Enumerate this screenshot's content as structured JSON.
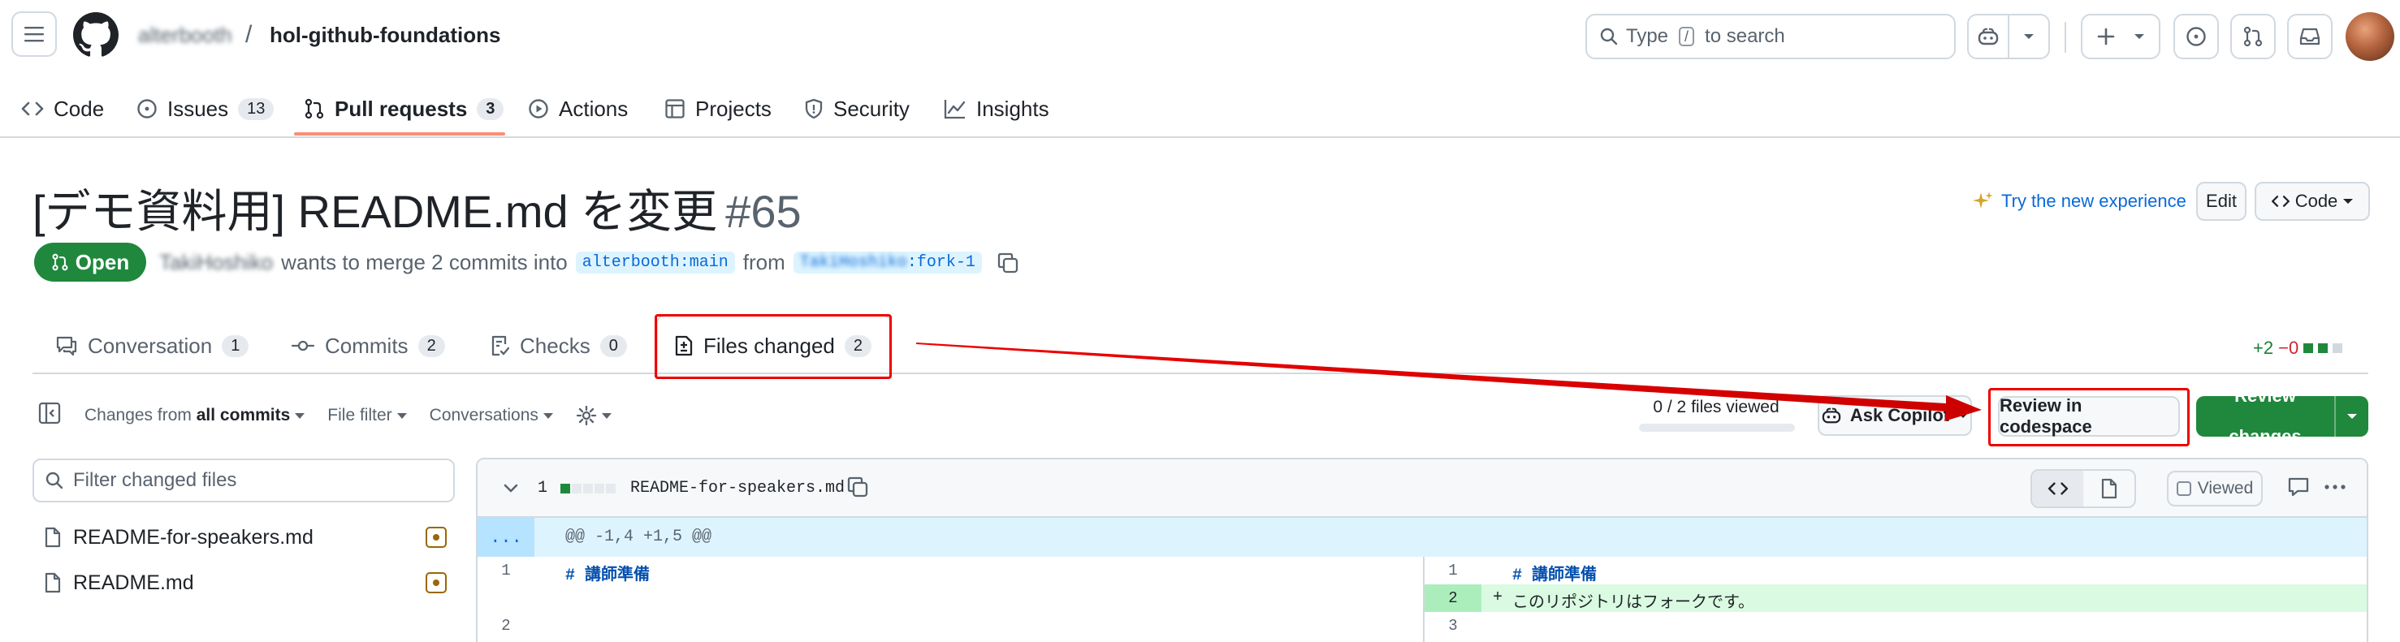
{
  "header": {
    "owner": "alterbooth",
    "separator": "/",
    "repo": "hol-github-foundations",
    "search_prefix": "Type",
    "search_key": "/",
    "search_suffix": "to search"
  },
  "repo_nav": [
    {
      "label": "Code",
      "icon": "code-icon"
    },
    {
      "label": "Issues",
      "count": "13",
      "icon": "issue-icon"
    },
    {
      "label": "Pull requests",
      "count": "3",
      "icon": "pull-request-icon",
      "active": true
    },
    {
      "label": "Actions",
      "icon": "play-icon"
    },
    {
      "label": "Projects",
      "icon": "table-icon"
    },
    {
      "label": "Security",
      "icon": "shield-icon"
    },
    {
      "label": "Insights",
      "icon": "graph-icon"
    }
  ],
  "pr": {
    "title": "[デモ資料用] README.md を変更",
    "number": "#65",
    "state": "Open",
    "author": "TakiHoshiko",
    "merge_text": "wants to merge 2 commits into",
    "base_branch": "alterbooth:main",
    "from_text": "from",
    "head_user": "TakiHoshiko",
    "head_branch": ":fork-1"
  },
  "top_actions": {
    "try_new": "Try the new experience",
    "edit": "Edit",
    "code": "Code"
  },
  "tabs": [
    {
      "label": "Conversation",
      "count": "1",
      "icon": "comment-icon"
    },
    {
      "label": "Commits",
      "count": "2",
      "icon": "commit-icon"
    },
    {
      "label": "Checks",
      "count": "0",
      "icon": "checklist-icon"
    },
    {
      "label": "Files changed",
      "count": "2",
      "icon": "file-diff-icon",
      "active": true
    }
  ],
  "diffstat": {
    "additions": "+2",
    "deletions": "−0"
  },
  "toolbar": {
    "changes_from_prefix": "Changes from",
    "changes_from_value": "all commits",
    "file_filter": "File filter",
    "conversations": "Conversations",
    "files_viewed": "0 / 2 files viewed",
    "files_viewed_fraction": 0,
    "ask_copilot": "Ask Copilot",
    "review_codespace": "Review in codespace",
    "review_changes": "Review changes"
  },
  "file_tree": {
    "filter_placeholder": "Filter changed files",
    "files": [
      {
        "name": "README-for-speakers.md",
        "status": "modified"
      },
      {
        "name": "README.md",
        "status": "modified"
      }
    ]
  },
  "diff": {
    "change_count": "1",
    "filename": "README-for-speakers.md",
    "viewed_label": "Viewed",
    "hunk_expand": "...",
    "hunk_header": "@@ -1,4 +1,5 @@",
    "lines": [
      {
        "left_num": "1",
        "left_text": "# 講師準備",
        "right_num": "1",
        "right_text": "# 講師準備"
      },
      {
        "left_num": "",
        "left_text": "",
        "right_num": "2",
        "right_marker": "+",
        "right_text": "このリポジトリはフォークです。",
        "added": true
      },
      {
        "left_num": "2",
        "left_text": "",
        "right_num": "3",
        "right_text": ""
      }
    ]
  },
  "colors": {
    "accent": "#0969da",
    "open_green": "#1f883d",
    "annotation_red": "#ee0000",
    "nav_underline": "#fd8c73"
  }
}
